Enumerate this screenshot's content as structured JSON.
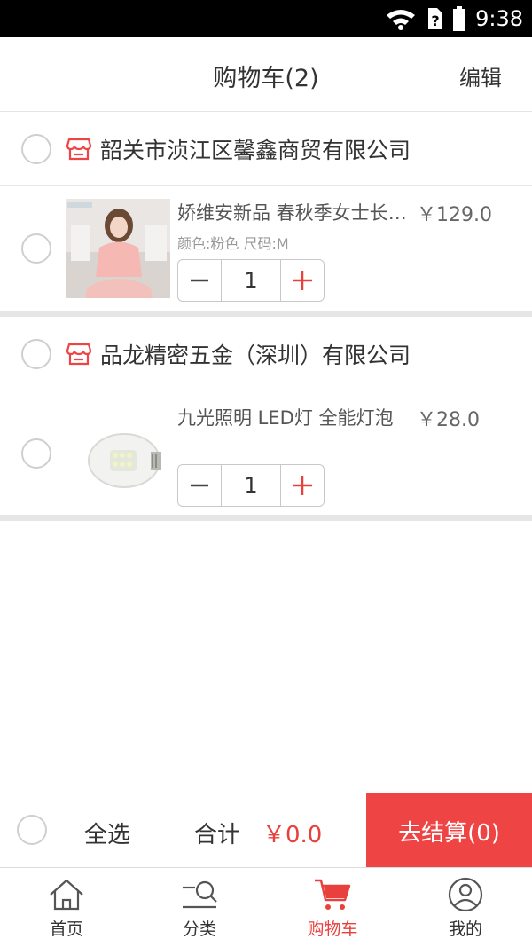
{
  "status_bar": {
    "time": "9:38"
  },
  "header": {
    "title": "购物车(2)",
    "edit_label": "编辑"
  },
  "shops": [
    {
      "name": "韶关市浈江区馨鑫商贸有限公司",
      "items": [
        {
          "title": "娇维安新品 春秋季女士长袖睡衣",
          "price": "￥129.0",
          "spec": "颜色:粉色 尺码:M",
          "qty": "1",
          "thumb_icon": "pajamas-photo"
        }
      ]
    },
    {
      "name": "品龙精密五金（深圳）有限公司",
      "items": [
        {
          "title": "九光照明 LED灯 全能灯泡",
          "price": "￥28.0",
          "spec": "",
          "qty": "1",
          "thumb_icon": "led-bulb-photo"
        }
      ]
    }
  ],
  "checkout": {
    "select_all_label": "全选",
    "total_label": "合计",
    "total_value": "￥0.0",
    "button_label": "去结算(0)"
  },
  "tabbar": {
    "tabs": [
      {
        "label": "首页",
        "icon": "home-icon"
      },
      {
        "label": "分类",
        "icon": "category-search-icon"
      },
      {
        "label": "购物车",
        "icon": "cart-icon",
        "active": true
      },
      {
        "label": "我的",
        "icon": "user-icon"
      }
    ]
  },
  "colors": {
    "accent": "#ef4444",
    "text": "#333333",
    "muted": "#999999",
    "divider": "#e6e6e6",
    "status_bar": "#000000"
  }
}
